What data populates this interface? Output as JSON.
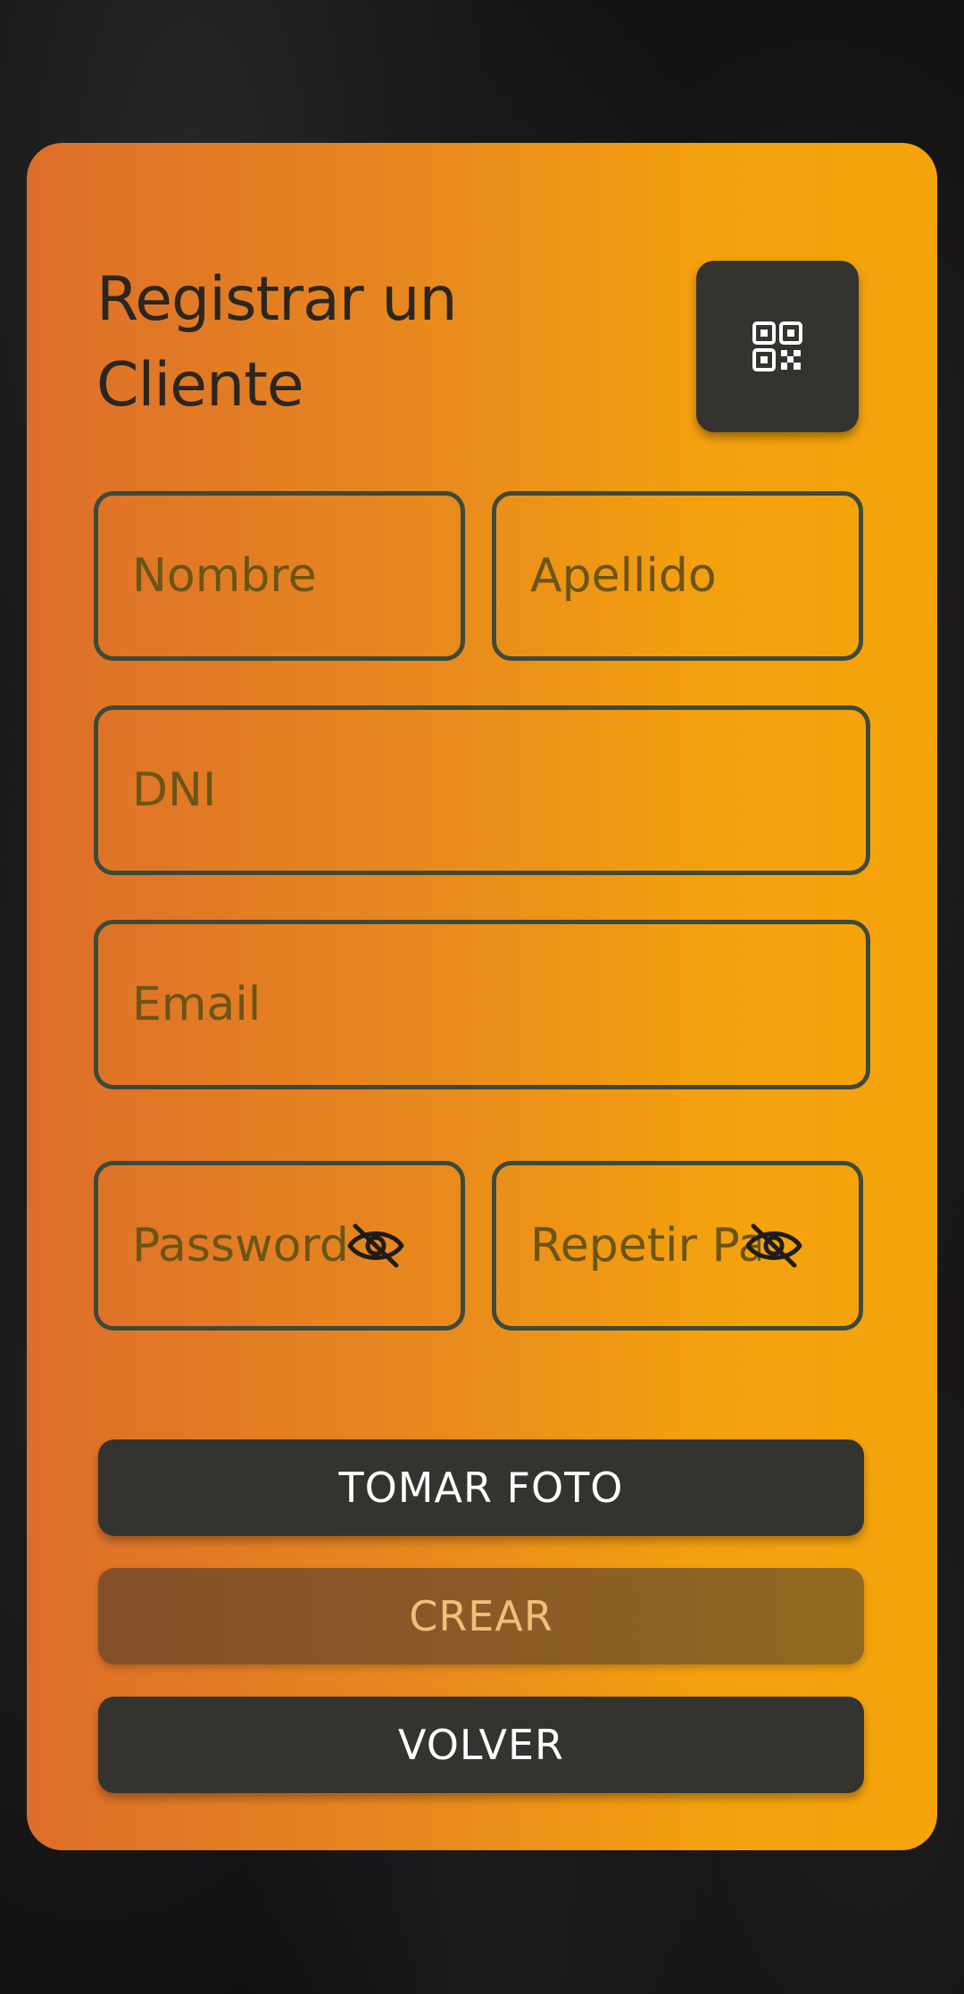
{
  "form": {
    "title": "Registrar un Cliente",
    "qr_button_icon": "qr-code-icon",
    "fields": {
      "nombre": {
        "placeholder": "Nombre",
        "value": ""
      },
      "apellido": {
        "placeholder": "Apellido",
        "value": ""
      },
      "dni": {
        "placeholder": "DNI",
        "value": ""
      },
      "email": {
        "placeholder": "Email",
        "value": ""
      },
      "password": {
        "placeholder": "Password",
        "value": "",
        "icon": "eye-off-icon"
      },
      "repeat_password": {
        "placeholder": "Repetir Password",
        "value": "",
        "icon": "eye-off-icon"
      }
    },
    "buttons": {
      "take_photo": "TOMAR FOTO",
      "create": "CREAR",
      "back": "VOLVER"
    }
  },
  "colors": {
    "card_gradient_start": "#dd6e2a",
    "card_gradient_end": "#f6a40b",
    "field_border": "#3d4a3a",
    "button_dark": "#34332f",
    "button_disabled_text": "#f0c07a"
  }
}
